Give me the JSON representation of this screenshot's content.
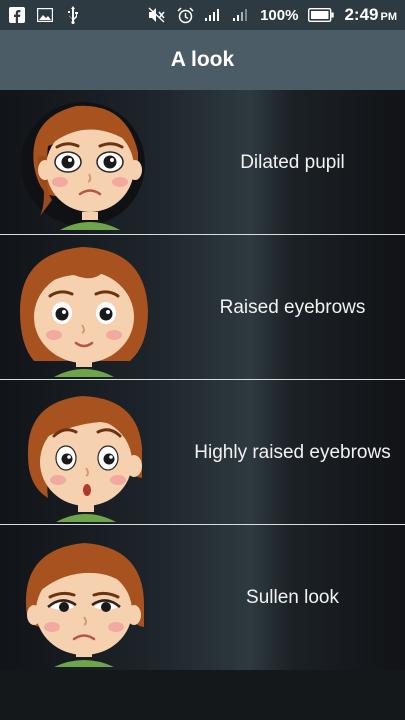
{
  "status_bar": {
    "battery_percent": "100%",
    "time": "2:49",
    "ampm": "PM",
    "icons": [
      "facebook-icon",
      "image-icon",
      "usb-icon",
      "mute-icon",
      "alarm-icon",
      "signal-icon",
      "signal-icon-2",
      "battery-icon"
    ]
  },
  "app_bar": {
    "title": "A look"
  },
  "items": [
    {
      "label": "Dilated pupil",
      "avatar": "girl-dilated-pupil-avatar"
    },
    {
      "label": "Raised eyebrows",
      "avatar": "girl-raised-eyebrows-avatar"
    },
    {
      "label": "Highly raised eyebrows",
      "avatar": "girl-highly-raised-eyebrows-avatar"
    },
    {
      "label": "Sullen look",
      "avatar": "girl-sullen-look-avatar"
    }
  ],
  "colors": {
    "status_bar": "#2e3a41",
    "app_bar": "#4b5c67",
    "list_background": "#15181b",
    "divider": "#d8dde0",
    "hair": "#a8521f",
    "skin": "#f6d1b0",
    "shirt": "#6ea54a"
  }
}
